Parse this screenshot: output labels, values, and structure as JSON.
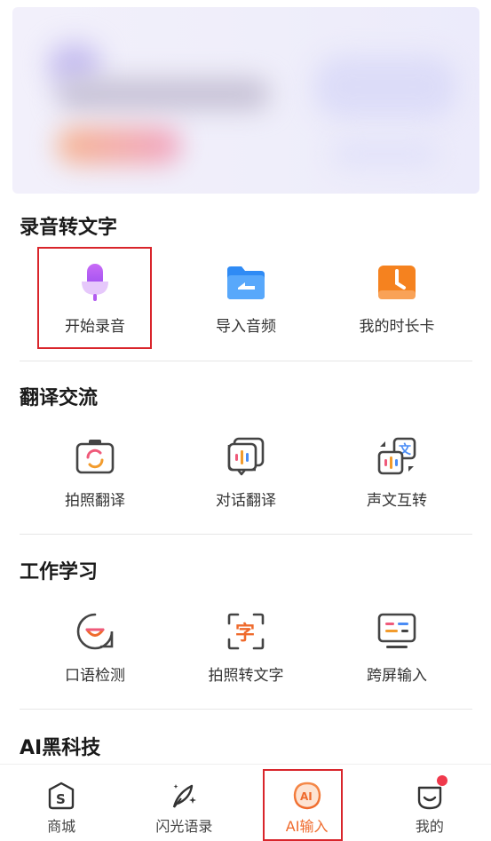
{
  "sections": [
    {
      "title": "录音转文字",
      "items": [
        {
          "label": "开始录音",
          "icon": "microphone-icon"
        },
        {
          "label": "导入音频",
          "icon": "folder-import-icon"
        },
        {
          "label": "我的时长卡",
          "icon": "clock-card-icon"
        }
      ]
    },
    {
      "title": "翻译交流",
      "items": [
        {
          "label": "拍照翻译",
          "icon": "camera-translate-icon"
        },
        {
          "label": "对话翻译",
          "icon": "dialog-translate-icon"
        },
        {
          "label": "声文互转",
          "icon": "voice-text-convert-icon"
        }
      ]
    },
    {
      "title": "工作学习",
      "items": [
        {
          "label": "口语检测",
          "icon": "speech-check-icon"
        },
        {
          "label": "拍照转文字",
          "icon": "photo-to-text-icon"
        },
        {
          "label": "跨屏输入",
          "icon": "cross-screen-icon"
        }
      ]
    },
    {
      "title": "AI黑科技"
    }
  ],
  "bottom_nav": [
    {
      "label": "商城",
      "icon": "shop-icon"
    },
    {
      "label": "闪光语录",
      "icon": "quill-sparkle-icon"
    },
    {
      "label": "AI输入",
      "icon": "ai-input-icon",
      "active": true
    },
    {
      "label": "我的",
      "icon": "profile-face-icon",
      "notification": true
    }
  ],
  "colors": {
    "accent": "#ef6a2c",
    "highlight": "#d9252b",
    "mic_purple": "#b35cf0",
    "folder_blue": "#2f8bf5",
    "clock_orange": "#f5821f"
  }
}
